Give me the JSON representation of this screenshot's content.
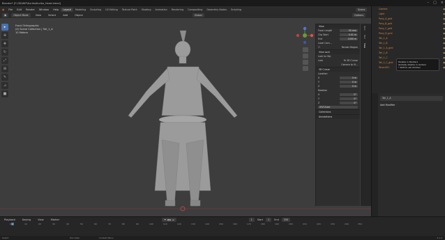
{
  "titlebar": {
    "title": "Blender* [F:\\3D\\WIP\\Kuriko\\Kuriko_Head.blend]"
  },
  "menubar": {
    "items": [
      "File",
      "Edit",
      "Render",
      "Window",
      "Help"
    ],
    "workspaces": [
      "Layout",
      "Modeling",
      "Sculpting",
      "UV Editing",
      "Texture Paint",
      "Shading",
      "Animation",
      "Rendering",
      "Compositing",
      "Geometry Nodes",
      "Scripting"
    ],
    "scene": "Scene",
    "view_layer": "ViewLayer"
  },
  "viewport_header": {
    "mode": "Object Mode",
    "menus": [
      "View",
      "Select",
      "Add",
      "Object"
    ],
    "orientation": "Global",
    "options": "Options"
  },
  "viewport_info": {
    "view": "Front Orthographic",
    "collection": "(4) Scene Collection | Tail_1_A",
    "units": "10 Meters"
  },
  "npanel": {
    "view_header": "View",
    "focal_length_label": "Focal Length",
    "focal_length": "50 mm",
    "clip_start_label": "Clip Start",
    "clip_start": "0.01 m",
    "clip_end_label": "End",
    "clip_end": "1000 m",
    "local_camera_label": "Local Cam...",
    "render_region": "Render Region",
    "view_lock_header": "View Lock",
    "lock_to_object_label": "Lock to Obj.",
    "lock_label": "Lock",
    "lock_cursor": "To 3D Cursor",
    "lock_camera": "Camera to Vi...",
    "cursor_header": "3D Cursor",
    "location_label": "Location",
    "x_label": "X",
    "y_label": "Y",
    "z_label": "Z",
    "loc_x": "0 m",
    "loc_y": "0 m",
    "loc_z": "0 m",
    "rotation_label": "Rotation",
    "rot_x": "0°",
    "rot_y": "0°",
    "rot_z": "0°",
    "rotation_mode": "XYZ Euler",
    "collections_header": "Collections",
    "annotations_header": "Annotations",
    "tabs": [
      "Item",
      "Tool",
      "View"
    ]
  },
  "outliner": {
    "rows": [
      "Camera",
      "Light",
      "Pony_A_grid",
      "Pony_B_grid",
      "Pony_C_grid",
      "Pony_D_grid",
      "Tail_1_A",
      "Tail_1_B",
      "Tail_1_A_grid",
      "Tail_1_B",
      "Tail_1_C",
      "Tail_1_C_grid",
      "Torso.001"
    ]
  },
  "tooltip": {
    "line1": "Disable in Renders",
    "line2": "Globally disable in renders",
    "line3": "* Shift to set children"
  },
  "properties": {
    "object_name": "Tail_1_A",
    "add_modifier": "Add Modifier"
  },
  "timeline": {
    "menus": [
      "Playback",
      "Keying",
      "View",
      "Marker"
    ],
    "current_frame": "1",
    "start_label": "Start",
    "start": "1",
    "end_label": "End",
    "end": "250",
    "ticks": [
      "0",
      "10",
      "20",
      "30",
      "40",
      "50",
      "60",
      "70",
      "80",
      "90",
      "100",
      "110",
      "120",
      "130",
      "140",
      "150",
      "160",
      "170",
      "180",
      "190",
      "200",
      "210",
      "220",
      "230",
      "240",
      "250"
    ]
  },
  "statusbar": {
    "select": "Select",
    "pan_view": "Pan View",
    "context_menu": "Context Menu",
    "version": "3.1.2"
  }
}
